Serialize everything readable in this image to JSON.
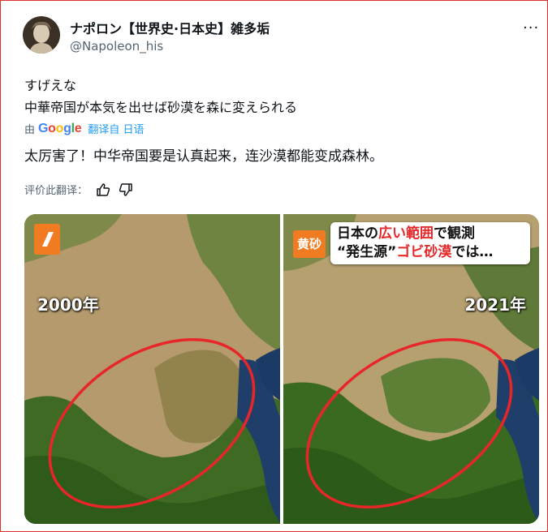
{
  "user": {
    "display_name": "ナポロン【世界史·日本史】雑多垢",
    "handle": "@Napoleon_his"
  },
  "tweet": {
    "line1": "すげえな",
    "line2": "中華帝国が本気を出せば砂漠を森に変えられる"
  },
  "translation": {
    "by_prefix": "由",
    "google": [
      "G",
      "o",
      "o",
      "g",
      "l",
      "e"
    ],
    "link": "翻译自 日语",
    "text": "太厉害了！中华帝国要是认真起来，连沙漠都能变成森林。",
    "rate_label": "评价此翻译："
  },
  "media": {
    "left_year": "2000年",
    "right_year": "2021年",
    "badge": "黄砂",
    "caption_l1_a": "日本の",
    "caption_l1_b": "広い範囲",
    "caption_l1_c": "で観測",
    "caption_l2_a": "“発生源”",
    "caption_l2_b": "ゴビ砂漠",
    "caption_l2_c": "では…"
  },
  "colors": {
    "link": "#1d9bf0",
    "ring": "#e8262a",
    "badge": "#f07b21"
  }
}
